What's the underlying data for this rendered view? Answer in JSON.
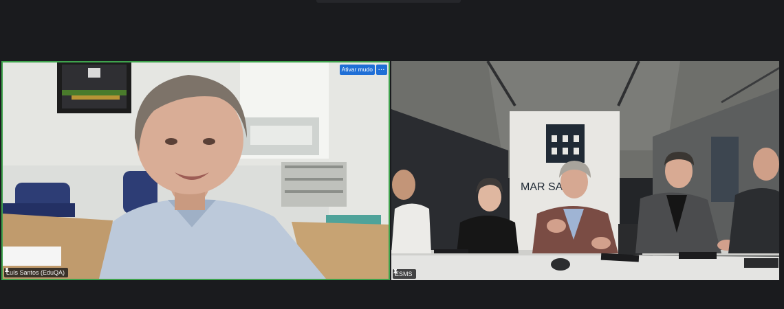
{
  "app": {
    "background": "#1a1b1e",
    "active_speaker_border": "#3fa34d"
  },
  "participants": [
    {
      "name": "Luís Santos (EduQA)",
      "pin_icon": "pin-icon",
      "controls": {
        "unmute_label": "Ativar mudo",
        "more_label": "···"
      }
    },
    {
      "name": "ESMS",
      "pin_icon": "pin-icon",
      "banner_text": "MAR SAR"
    }
  ],
  "colors": {
    "accent": "#1f6fd6"
  }
}
